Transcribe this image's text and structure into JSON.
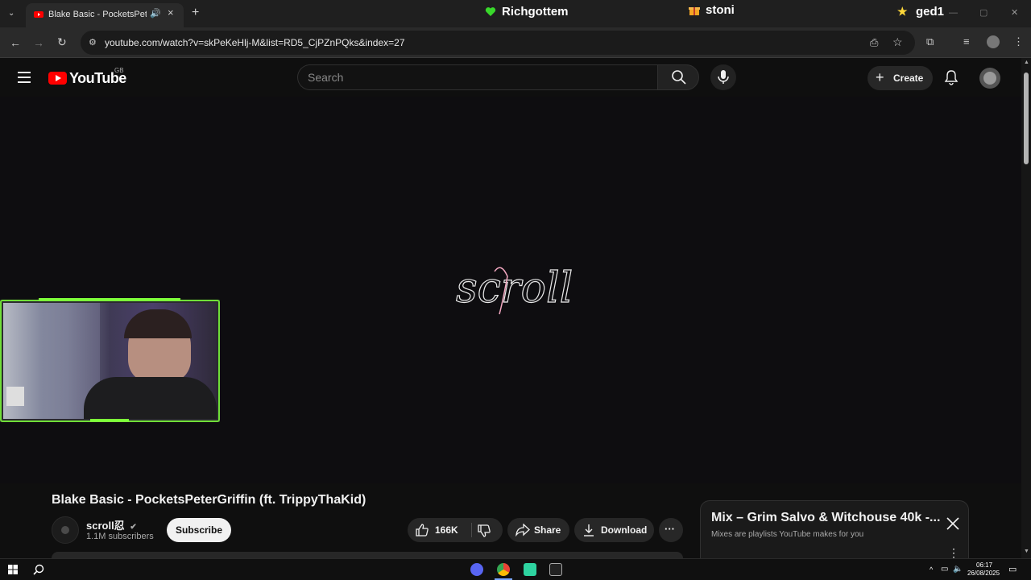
{
  "browser": {
    "tab_title": "Blake Basic - PocketsPeterG",
    "new_tab_symbol": "+",
    "tab_close_symbol": "×",
    "url": "youtube.com/watch?v=skPeKeHlj-M&list=RD5_CjPZnPQks&index=27",
    "window_controls": {
      "minimize": "—",
      "maximize": "▢",
      "close": "✕"
    }
  },
  "stream_overlay": {
    "names": [
      {
        "label": "Richgottem",
        "icon": "green-heart"
      },
      {
        "label": "stoni",
        "icon": "gift"
      },
      {
        "label": "ged1",
        "icon": "star"
      }
    ]
  },
  "youtube": {
    "logo_text": "YouTube",
    "region": "GB",
    "search_placeholder": "Search",
    "create_label": "Create",
    "video_logo_text": "scroll忍"
  },
  "video": {
    "title": "Blake Basic - PocketsPeterGriffin (ft. TrippyThaKid)",
    "channel_name": "scroll忍",
    "verified": true,
    "subscribers": "1.1M subscribers",
    "subscribe_label": "Subscribe",
    "like_count": "166K",
    "share_label": "Share",
    "download_label": "Download",
    "more_symbol": "···"
  },
  "mix": {
    "title": "Mix – Grim Salvo & Witchouse 40k -...",
    "subtitle": "Mixes are playlists YouTube makes for you",
    "more_symbol": "⋮"
  },
  "taskbar": {
    "time": "06:17",
    "date": "26/08/2025"
  },
  "colors": {
    "brand_red": "#ff0000",
    "webcam_frame_green": "#7dff3a",
    "overlay_heart": "#39d82b",
    "overlay_gift": "#f5a623",
    "overlay_star": "#ffd83a"
  }
}
